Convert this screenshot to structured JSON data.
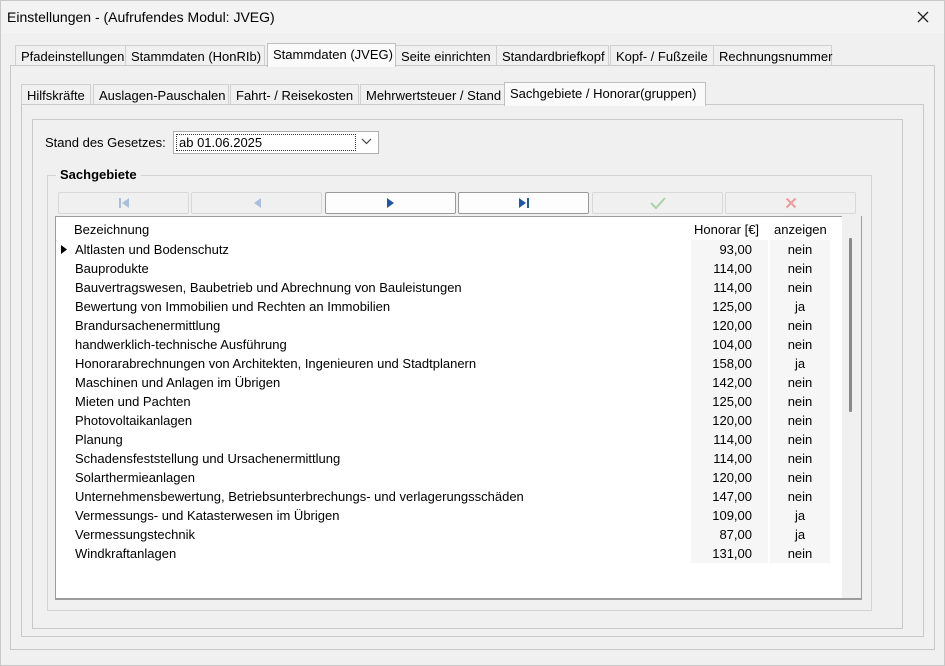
{
  "window": {
    "title": "Einstellungen  -  (Aufrufendes Modul: JVEG)"
  },
  "tabs_main": [
    {
      "label": "Pfadeinstellungen"
    },
    {
      "label": "Stammdaten (HonRIb)"
    },
    {
      "label": "Stammdaten (JVEG)"
    },
    {
      "label": "Seite einrichten"
    },
    {
      "label": "Standardbriefkopf"
    },
    {
      "label": "Kopf- / Fußzeile"
    },
    {
      "label": "Rechnungsnummer"
    }
  ],
  "tabs_sub": [
    {
      "label": "Hilfskräfte"
    },
    {
      "label": "Auslagen-Pauschalen"
    },
    {
      "label": "Fahrt- / Reisekosten"
    },
    {
      "label": "Mehrwertsteuer / Stand"
    },
    {
      "label": "Sachgebiete / Honorar(gruppen)"
    }
  ],
  "stand": {
    "label": "Stand des Gesetzes:",
    "value": "ab 01.06.2025"
  },
  "sachgebiete": {
    "group_label": "Sachgebiete",
    "nav": {
      "first_icon": "first-record-icon",
      "prev_icon": "previous-record-icon",
      "next_icon": "next-record-icon",
      "last_icon": "last-record-icon",
      "post_icon": "checkmark-icon",
      "cancel_icon": "x-icon"
    },
    "columns": {
      "bezeichnung": "Bezeichnung",
      "honorar": "Honorar [€]",
      "anzeigen": "anzeigen"
    },
    "rows": [
      {
        "bezeichnung": "Altlasten und Bodenschutz",
        "honorar": "93,00",
        "anzeigen": "nein"
      },
      {
        "bezeichnung": "Bauprodukte",
        "honorar": "114,00",
        "anzeigen": "nein"
      },
      {
        "bezeichnung": "Bauvertragswesen, Baubetrieb und Abrechnung von Bauleistungen",
        "honorar": "114,00",
        "anzeigen": "nein"
      },
      {
        "bezeichnung": "Bewertung von Immobilien und Rechten an Immobilien",
        "honorar": "125,00",
        "anzeigen": "ja"
      },
      {
        "bezeichnung": "Brandursachenermittlung",
        "honorar": "120,00",
        "anzeigen": "nein"
      },
      {
        "bezeichnung": "handwerklich-technische Ausführung",
        "honorar": "104,00",
        "anzeigen": "nein"
      },
      {
        "bezeichnung": "Honorarabrechnungen von Architekten, Ingenieuren und Stadtplanern",
        "honorar": "158,00",
        "anzeigen": "ja"
      },
      {
        "bezeichnung": "Maschinen und Anlagen im Übrigen",
        "honorar": "142,00",
        "anzeigen": "nein"
      },
      {
        "bezeichnung": "Mieten und Pachten",
        "honorar": "125,00",
        "anzeigen": "nein"
      },
      {
        "bezeichnung": "Photovoltaikanlagen",
        "honorar": "120,00",
        "anzeigen": "nein"
      },
      {
        "bezeichnung": "Planung",
        "honorar": "114,00",
        "anzeigen": "nein"
      },
      {
        "bezeichnung": "Schadensfeststellung und Ursachenermittlung",
        "honorar": "114,00",
        "anzeigen": "nein"
      },
      {
        "bezeichnung": "Solarthermieanlagen",
        "honorar": "120,00",
        "anzeigen": "nein"
      },
      {
        "bezeichnung": "Unternehmensbewertung, Betriebsunterbrechungs- und verlagerungsschäden",
        "honorar": "147,00",
        "anzeigen": "nein"
      },
      {
        "bezeichnung": "Vermessungs- und Katasterwesen im Übrigen",
        "honorar": "109,00",
        "anzeigen": "ja"
      },
      {
        "bezeichnung": "Vermessungstechnik",
        "honorar": "87,00",
        "anzeigen": "ja"
      },
      {
        "bezeichnung": "Windkraftanlagen",
        "honorar": "131,00",
        "anzeigen": "nein"
      }
    ]
  },
  "colors": {
    "accent_nav": "#1f57a6",
    "disabled_nav": "#a9bfdc",
    "ok_disabled": "#a8d3a8",
    "cancel_disabled": "#ef9b9b"
  }
}
